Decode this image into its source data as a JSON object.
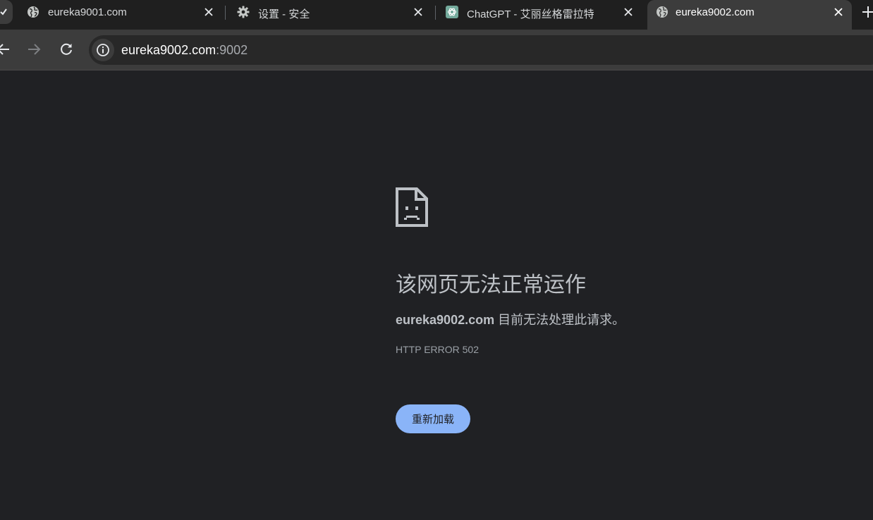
{
  "tabs": [
    {
      "title": "eureka9001.com",
      "icon": "globe-icon",
      "active": false
    },
    {
      "title": "设置 - 安全",
      "icon": "gear-icon",
      "active": false
    },
    {
      "title": "ChatGPT - 艾丽丝格雷拉特",
      "icon": "chatgpt-icon",
      "active": false
    },
    {
      "title": "eureka9002.com",
      "icon": "globe-icon",
      "active": true
    }
  ],
  "omnibox": {
    "host": "eureka9002.com",
    "port": ":9002"
  },
  "error_page": {
    "heading": "该网页无法正常运作",
    "host": "eureka9002.com",
    "message": " 目前无法处理此请求。",
    "error_code": "HTTP ERROR 502",
    "reload_label": "重新加载"
  },
  "colors": {
    "background": "#202124",
    "toolbar": "#3c3c3c",
    "accent": "#8ab4f8",
    "chatgpt_brand": "#74aa9c"
  }
}
